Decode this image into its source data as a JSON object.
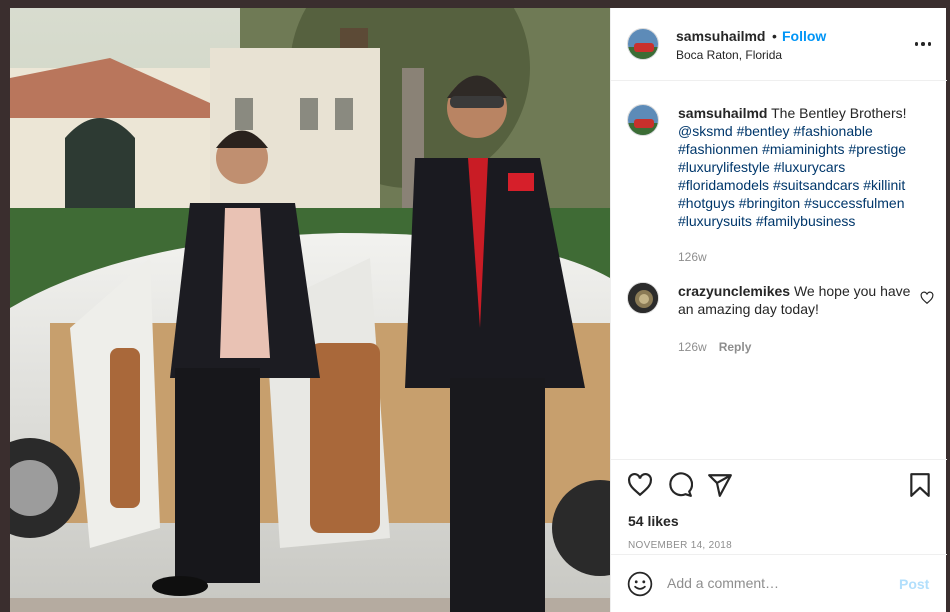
{
  "post": {
    "username": "samsuhailmd",
    "dot": "•",
    "follow_label": "Follow",
    "location": "Boca Raton, Florida",
    "more_icon": "more-options-icon"
  },
  "caption": {
    "username": "samsuhailmd",
    "text": "The Bentley Brothers!",
    "tags": [
      "@sksmd",
      "#bentley",
      "#fashionable",
      "#fashionmen",
      "#miaminights",
      "#prestige",
      "#luxurylifestyle",
      "#luxurycars",
      "#floridamodels",
      "#suitsandcars",
      "#killinit",
      "#hotguys",
      "#bringiton",
      "#successfulmen",
      "#luxurysuits",
      "#familybusiness"
    ],
    "age": "126w"
  },
  "comments": [
    {
      "username": "crazyunclemikes",
      "text": "We hope you have an amazing day today!",
      "age": "126w",
      "reply_label": "Reply"
    }
  ],
  "actions": {
    "likes": "54 likes",
    "date": "NOVEMBER 14, 2018",
    "icons": [
      "like-heart-icon",
      "comment-bubble-icon",
      "share-paper-plane-icon",
      "save-bookmark-icon"
    ]
  },
  "add_comment": {
    "placeholder": "Add a comment…",
    "post_label": "Post"
  },
  "colors": {
    "link_blue": "#0095f6",
    "hashtag": "#00376b",
    "muted": "#8e8e8e",
    "post_disabled": "#b2dffc"
  }
}
